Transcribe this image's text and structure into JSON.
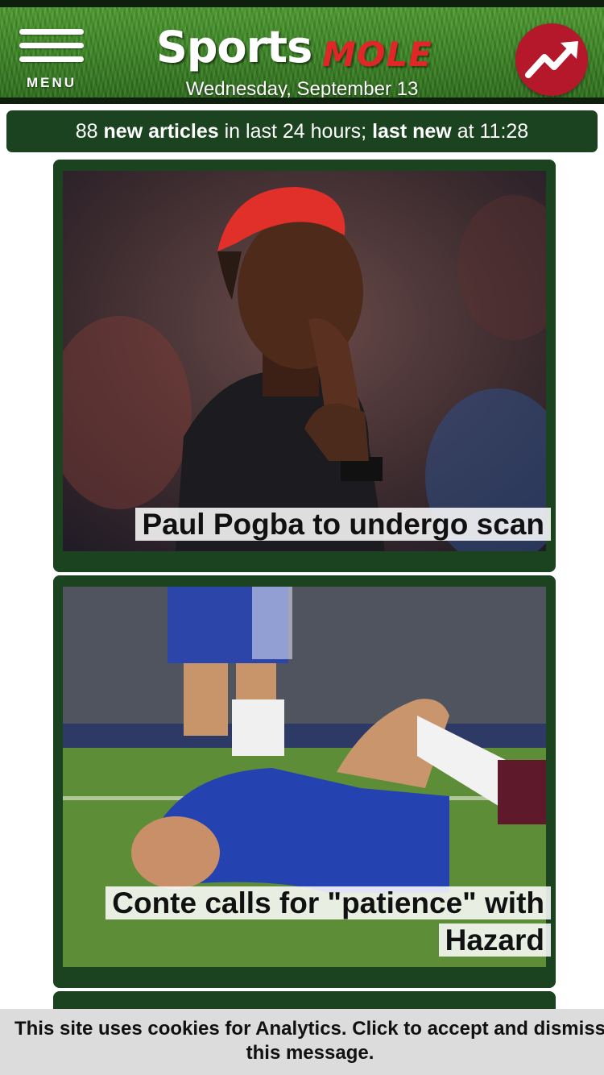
{
  "header": {
    "menu_label": "MENU",
    "logo": {
      "part1": "Sports",
      "part2": "MOLE"
    },
    "date": "Wednesday, September 13",
    "trending_icon": "trending-up-icon"
  },
  "infobar": {
    "count": "88",
    "new_articles": "new articles",
    "in_last": "in last 24 hours;",
    "last_new": "last new",
    "at": "at",
    "time": "11:28"
  },
  "articles": [
    {
      "headline": "Paul Pogba to undergo scan"
    },
    {
      "headline": "Conte calls for \"patience\" with Hazard"
    }
  ],
  "cookie": {
    "message": "This site uses cookies for Analytics. Click to accept and dismiss this message."
  },
  "colors": {
    "header_green": "#3b8524",
    "dark_green": "#1b4320",
    "brand_red": "#e22527",
    "trend_red": "#b4182a",
    "cookie_bg": "#dcdcdc"
  }
}
